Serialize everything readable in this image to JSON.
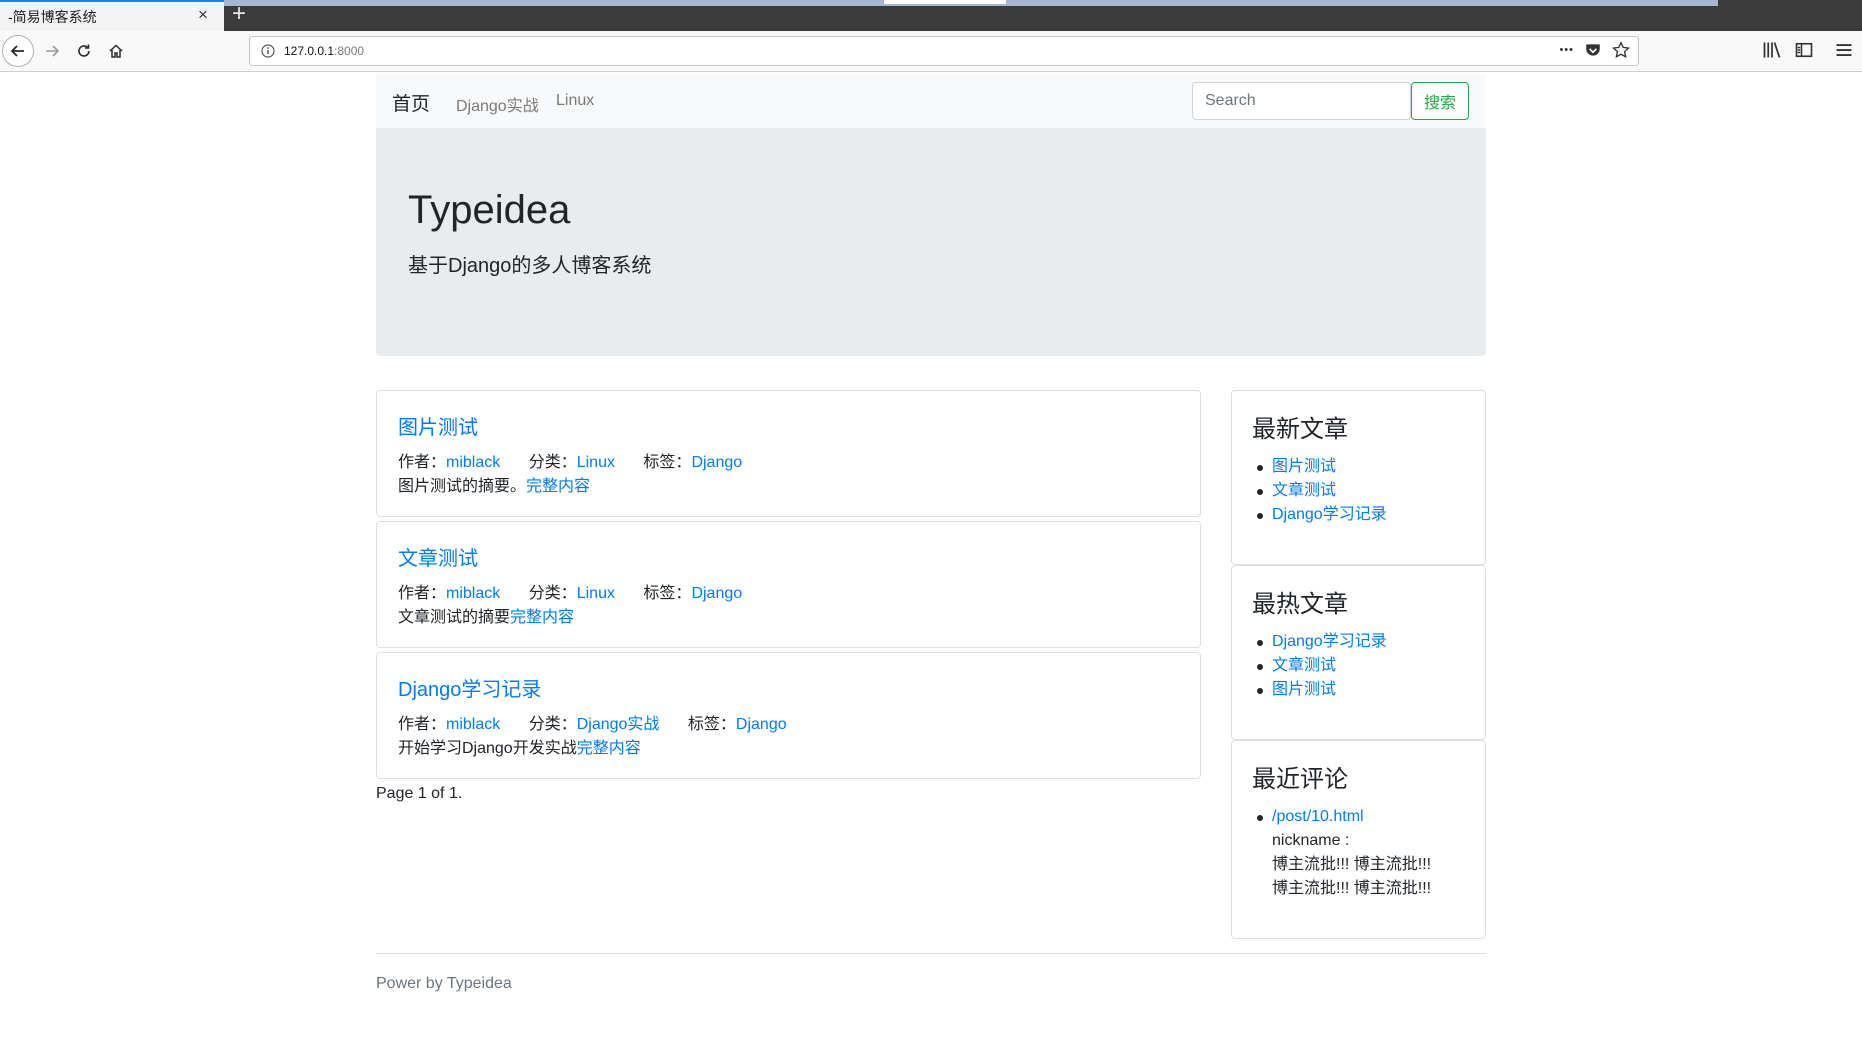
{
  "browser": {
    "tab_title": "-简易博客系统",
    "new_tab": "+",
    "close": "×",
    "url_host": "127.0.0.1",
    "url_port": ":8000",
    "more_dots": "•••"
  },
  "navbar": {
    "brand": "首页",
    "links": [
      "Django实战",
      "Linux"
    ],
    "search_placeholder": "Search",
    "search_button": "搜索"
  },
  "jumbotron": {
    "title": "Typeidea",
    "subtitle": "基于Django的多人博客系统"
  },
  "posts": [
    {
      "title": "图片测试",
      "author_label": "作者：",
      "author": "miblack",
      "category_label": "分类：",
      "category": "Linux",
      "tag_label": "标签：",
      "tag": "Django",
      "summary": "图片测试的摘要。",
      "more": "完整内容"
    },
    {
      "title": "文章测试",
      "author_label": "作者：",
      "author": "miblack",
      "category_label": "分类：",
      "category": "Linux",
      "tag_label": "标签：",
      "tag": "Django",
      "summary": "文章测试的摘要",
      "more": "完整内容"
    },
    {
      "title": "Django学习记录",
      "author_label": "作者：",
      "author": "miblack",
      "category_label": "分类：",
      "category": "Django实战",
      "tag_label": "标签：",
      "tag": "Django",
      "summary": "开始学习Django开发实战",
      "more": "完整内容"
    }
  ],
  "pagination": "Page 1 of 1.",
  "sidebar": {
    "latest": {
      "title": "最新文章",
      "items": [
        "图片测试",
        "文章测试",
        "Django学习记录"
      ]
    },
    "hot": {
      "title": "最热文章",
      "items": [
        "Django学习记录",
        "文章测试",
        "图片测试"
      ]
    },
    "comments": {
      "title": "最近评论",
      "link": "/post/10.html",
      "nickname": "nickname :",
      "content_line1": "博主流批!!! 博主流批!!!",
      "content_line2": "博主流批!!! 博主流批!!!"
    }
  },
  "footer": "Power by Typeidea",
  "colors": {
    "link": "#007bff",
    "success": "#28a745",
    "jumbotron_bg": "#e9ecef"
  }
}
